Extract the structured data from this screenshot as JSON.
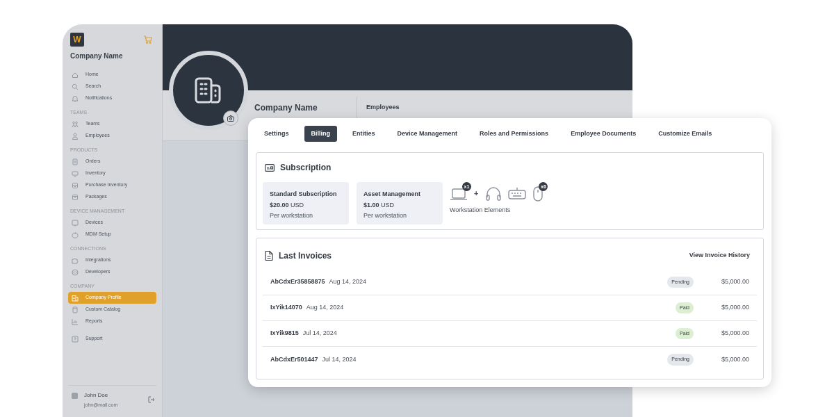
{
  "sidebar": {
    "logo": "W",
    "company": "Company Name",
    "sections": [
      {
        "items": [
          {
            "label": "Home",
            "selected": false
          },
          {
            "label": "Search",
            "selected": false
          },
          {
            "label": "Notifications",
            "selected": false
          }
        ]
      },
      {
        "title": "TEAMS",
        "items": [
          {
            "label": "Teams",
            "selected": false
          },
          {
            "label": "Employees",
            "selected": false
          }
        ]
      },
      {
        "title": "PRODUCTS",
        "items": [
          {
            "label": "Orders",
            "selected": false
          },
          {
            "label": "Inventory",
            "selected": false
          },
          {
            "label": "Purchase Inventory",
            "selected": false
          },
          {
            "label": "Packages",
            "selected": false
          }
        ]
      },
      {
        "title": "DEVICE MANAGEMENT",
        "items": [
          {
            "label": "Devices",
            "selected": false
          },
          {
            "label": "MDM Setup",
            "selected": false
          }
        ]
      },
      {
        "title": "CONNECTIONS",
        "items": [
          {
            "label": "Integrations",
            "selected": false
          },
          {
            "label": "Developers",
            "selected": false
          }
        ]
      },
      {
        "title": "COMPANY",
        "items": [
          {
            "label": "Company Profile",
            "selected": true
          },
          {
            "label": "Custom Catalog",
            "selected": false
          },
          {
            "label": "Reports",
            "selected": false
          }
        ]
      },
      {
        "items": [
          {
            "label": "Support",
            "selected": false
          }
        ]
      }
    ],
    "user": {
      "name": "John Doe",
      "email": "john@mail.com"
    }
  },
  "profile": {
    "name": "Company Name",
    "stat_label": "Employees"
  },
  "tabs": [
    {
      "label": "Settings",
      "selected": false
    },
    {
      "label": "Billing",
      "selected": true
    },
    {
      "label": "Entities",
      "selected": false
    },
    {
      "label": "Device Management",
      "selected": false
    },
    {
      "label": "Roles and Permissions",
      "selected": false
    },
    {
      "label": "Employee Documents",
      "selected": false
    },
    {
      "label": "Customize Emails",
      "selected": false
    }
  ],
  "subscription": {
    "title": "Subscription",
    "plans": [
      {
        "name": "Standard Subscription",
        "price": "$20.00",
        "currency": "USD",
        "unit": "Per workstation"
      },
      {
        "name": "Asset Management",
        "price": "$1.00",
        "currency": "USD",
        "unit": "Per workstation"
      }
    ],
    "workstation": {
      "label": "Workstation Elements",
      "items": [
        {
          "kind": "laptop",
          "badge": "x1"
        },
        {
          "kind": "plus",
          "text": "+"
        },
        {
          "kind": "headset"
        },
        {
          "kind": "keyboard"
        },
        {
          "kind": "mouse",
          "badge": "x6"
        }
      ]
    }
  },
  "invoices": {
    "title": "Last Invoices",
    "link": "View Invoice History",
    "rows": [
      {
        "id": "AbCdxEr35858875",
        "date": "Aug 14, 2024",
        "status": "Pending",
        "color": "#e4e7eb",
        "amount": "$5,000.00"
      },
      {
        "id": "IxYik14070",
        "date": "Aug 14, 2024",
        "status": "Paid",
        "color": "#dcefd3",
        "amount": "$5,000.00"
      },
      {
        "id": "IxYik9815",
        "date": "Jul 14, 2024",
        "status": "Paid",
        "color": "#dcefd3",
        "amount": "$5,000.00"
      },
      {
        "id": "AbCdxEr501447",
        "date": "Jul 14, 2024",
        "status": "Pending",
        "color": "#e4e7eb",
        "amount": "$5,000.00"
      }
    ]
  }
}
